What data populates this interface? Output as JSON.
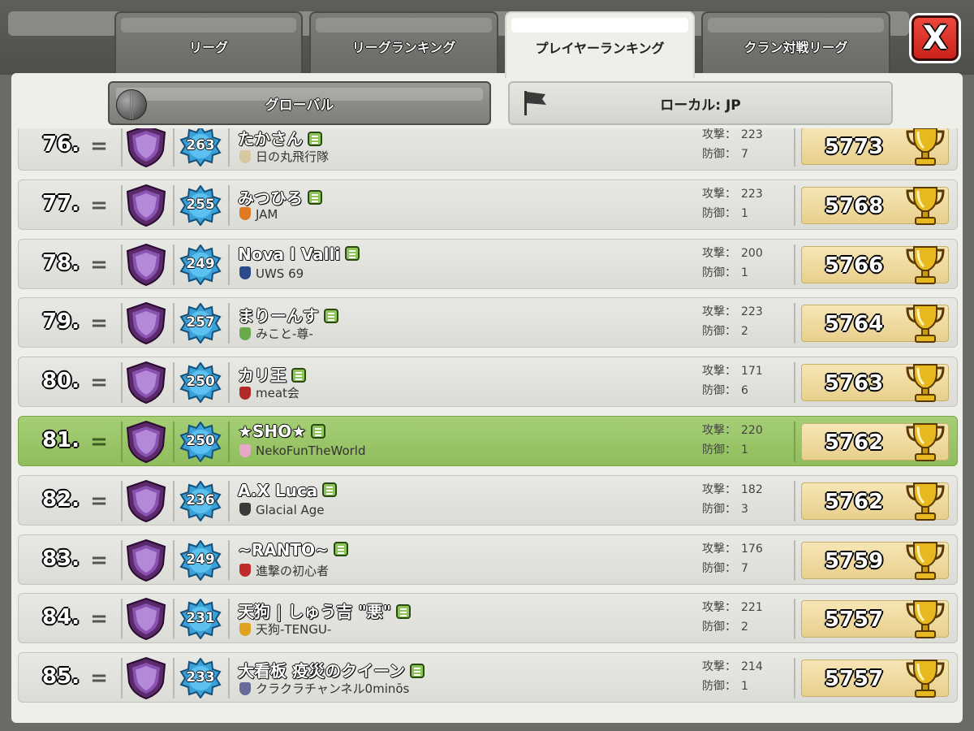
{
  "tabs": [
    {
      "label": "リーグ",
      "active": false
    },
    {
      "label": "リーグランキング",
      "active": false
    },
    {
      "label": "プレイヤーランキング",
      "active": true
    },
    {
      "label": "クラン対戦リーグ",
      "active": false
    }
  ],
  "close_label": "X",
  "filters": {
    "global": "グローバル",
    "local": "ローカル: JP"
  },
  "stat_labels": {
    "attack": "攻撃：",
    "defense": "防御："
  },
  "rows": [
    {
      "rank": "76.",
      "change": "=",
      "level": "263",
      "name": "たかさん",
      "clan": "日の丸飛行隊",
      "clan_color": "#d8c8a0",
      "attack": "223",
      "defense": "7",
      "trophies": "5773",
      "highlight": false
    },
    {
      "rank": "77.",
      "change": "=",
      "level": "255",
      "name": "みつひろ",
      "clan": "JAM",
      "clan_color": "#e07a20",
      "attack": "223",
      "defense": "1",
      "trophies": "5768",
      "highlight": false
    },
    {
      "rank": "78.",
      "change": "=",
      "level": "249",
      "name": "Nova l Valli",
      "clan": "UWS 69",
      "clan_color": "#2a4a8a",
      "attack": "200",
      "defense": "1",
      "trophies": "5766",
      "highlight": false
    },
    {
      "rank": "79.",
      "change": "=",
      "level": "257",
      "name": "まりーんす",
      "clan": "みこと-尊-",
      "clan_color": "#6aaa4a",
      "attack": "223",
      "defense": "2",
      "trophies": "5764",
      "highlight": false
    },
    {
      "rank": "80.",
      "change": "=",
      "level": "250",
      "name": "カリ王",
      "clan": "meat会",
      "clan_color": "#b02a2a",
      "attack": "171",
      "defense": "6",
      "trophies": "5763",
      "highlight": false
    },
    {
      "rank": "81.",
      "change": "=",
      "level": "250",
      "name": "★SHO★",
      "clan": "NekoFunTheWorld",
      "clan_color": "#e8a8c8",
      "attack": "220",
      "defense": "1",
      "trophies": "5762",
      "highlight": true
    },
    {
      "rank": "82.",
      "change": "=",
      "level": "236",
      "name": "A.X Luca",
      "clan": "Glacial Age",
      "clan_color": "#3a3a3a",
      "attack": "182",
      "defense": "3",
      "trophies": "5762",
      "highlight": false
    },
    {
      "rank": "83.",
      "change": "=",
      "level": "249",
      "name": "~RANTO~",
      "clan": "進撃の初心者",
      "clan_color": "#c02a2a",
      "attack": "176",
      "defense": "7",
      "trophies": "5759",
      "highlight": false
    },
    {
      "rank": "84.",
      "change": "=",
      "level": "231",
      "name": "天狗 | しゅう吉 \"悪\"",
      "clan": "天狗-TENGU-",
      "clan_color": "#e0a020",
      "attack": "221",
      "defense": "2",
      "trophies": "5757",
      "highlight": false
    },
    {
      "rank": "85.",
      "change": "=",
      "level": "233",
      "name": "大看板 疫災のクイーン",
      "clan": "クラクラチャンネル0minōs",
      "clan_color": "#6a6a9a",
      "attack": "214",
      "defense": "1",
      "trophies": "5757",
      "highlight": false
    }
  ]
}
